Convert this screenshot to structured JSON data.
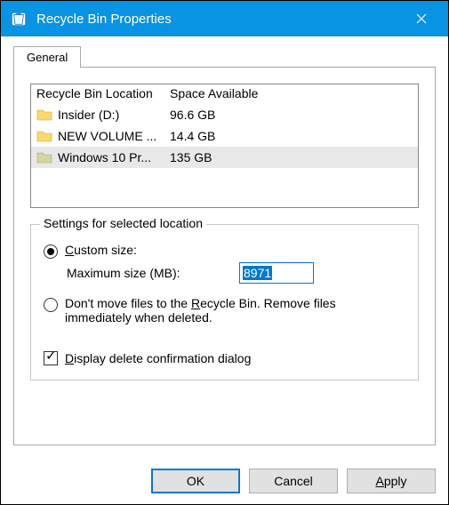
{
  "window": {
    "title": "Recycle Bin Properties"
  },
  "tabs": {
    "general": "General"
  },
  "list": {
    "header_location": "Recycle Bin Location",
    "header_space": "Space Available",
    "rows": [
      {
        "name": "Insider (D:)",
        "space": "96.6 GB"
      },
      {
        "name": "NEW VOLUME ...",
        "space": "14.4 GB"
      },
      {
        "name": "Windows 10 Pr...",
        "space": "135 GB"
      }
    ]
  },
  "settings": {
    "group_title": "Settings for selected location",
    "custom_size_label_pre": "C",
    "custom_size_label_post": "ustom size:",
    "max_size_label": "Maximum size (MB):",
    "max_size_value": "8971",
    "dont_move_pre": "Don't move files to the ",
    "dont_move_u": "R",
    "dont_move_post": "ecycle Bin. Remove files immediately when deleted.",
    "confirm_u": "D",
    "confirm_post": "isplay delete confirmation dialog"
  },
  "buttons": {
    "ok": "OK",
    "cancel": "Cancel",
    "apply_u": "A",
    "apply_post": "pply"
  }
}
